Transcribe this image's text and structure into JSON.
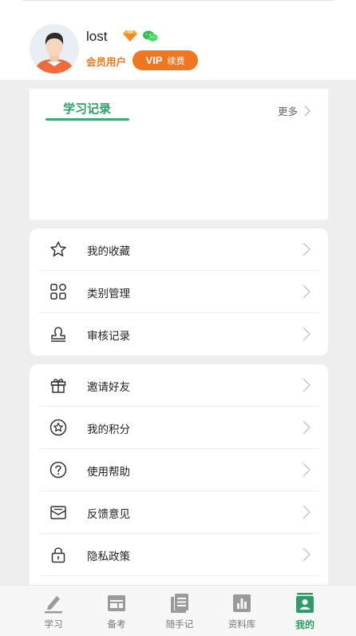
{
  "profile": {
    "username": "lost",
    "member_label": "会员用户",
    "vip_text": "VIP",
    "renew_text": "续费"
  },
  "study": {
    "title": "学习记录",
    "more": "更多"
  },
  "menu_group1": [
    {
      "label": "我的收藏",
      "icon": "star-icon"
    },
    {
      "label": "类别管理",
      "icon": "grid-icon"
    },
    {
      "label": "审核记录",
      "icon": "stamp-icon"
    }
  ],
  "menu_group2": [
    {
      "label": "邀请好友",
      "icon": "gift-icon"
    },
    {
      "label": "我的积分",
      "icon": "points-star-icon"
    },
    {
      "label": "使用帮助",
      "icon": "help-icon"
    },
    {
      "label": "反馈意见",
      "icon": "feedback-mail-icon"
    },
    {
      "label": "隐私政策",
      "icon": "lock-icon"
    }
  ],
  "tabs": [
    {
      "label": "学习",
      "icon": "pen-icon"
    },
    {
      "label": "备考",
      "icon": "calendar-board-icon"
    },
    {
      "label": "随手记",
      "icon": "notes-icon"
    },
    {
      "label": "资料库",
      "icon": "bar-chart-icon"
    },
    {
      "label": "我的",
      "icon": "profile-card-icon",
      "active": true
    }
  ],
  "colors": {
    "accent_green": "#2f9c67",
    "accent_orange": "#f0771f",
    "background": "#eeeeee"
  }
}
